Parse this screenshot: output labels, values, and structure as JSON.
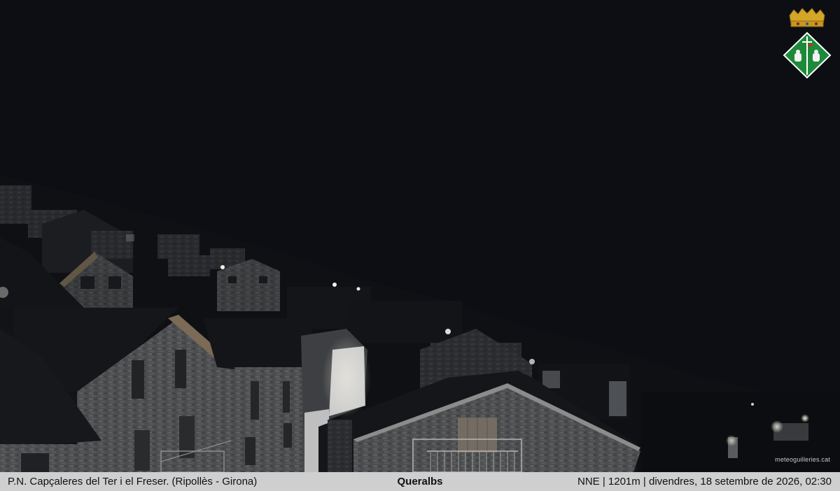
{
  "image": {
    "watermark": "meteoguilleries.cat",
    "coat_of_arms": "queralbs-coat-of-arms"
  },
  "caption": {
    "left": "P.N. Capçaleres del Ter i el Freser. (Ripollès - Girona)",
    "center": "Queralbs",
    "right": "NNE | 1201m | divendres, 18 setembre de 2026, 02:30"
  },
  "colors": {
    "sky": "#0d0e13",
    "caption_bg": "#cfcfcf",
    "stone": "#4a4c4e",
    "roof": "#141518",
    "crown": "#d4a628",
    "shield": "#1d8a3a"
  }
}
